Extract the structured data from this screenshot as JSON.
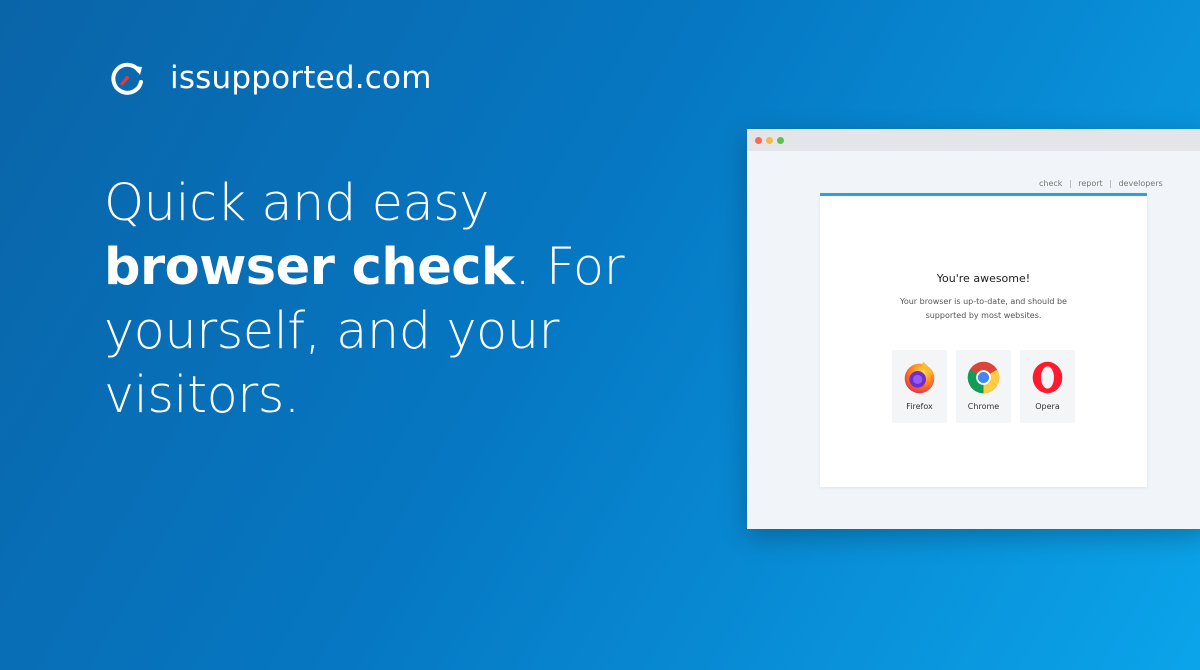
{
  "brand": {
    "name": "issupported.com",
    "icon": "refresh-clock-icon"
  },
  "headline": {
    "line1": "Quick and easy",
    "bold": "browser check",
    "rest": ". For yourself, and your visitors."
  },
  "mockup": {
    "nav": {
      "check": "check",
      "report": "report",
      "developers": "developers",
      "separator": "|"
    },
    "card": {
      "title": "You're awesome!",
      "description": "Your browser is up-to-date, and should be supported by most websites."
    },
    "browsers": [
      {
        "name": "Firefox",
        "icon": "firefox-icon"
      },
      {
        "name": "Chrome",
        "icon": "chrome-icon"
      },
      {
        "name": "Opera",
        "icon": "opera-icon"
      }
    ]
  },
  "colors": {
    "accent": "#2aa3dc",
    "background_start": "#0a64a8",
    "background_end": "#0ba4ea"
  }
}
